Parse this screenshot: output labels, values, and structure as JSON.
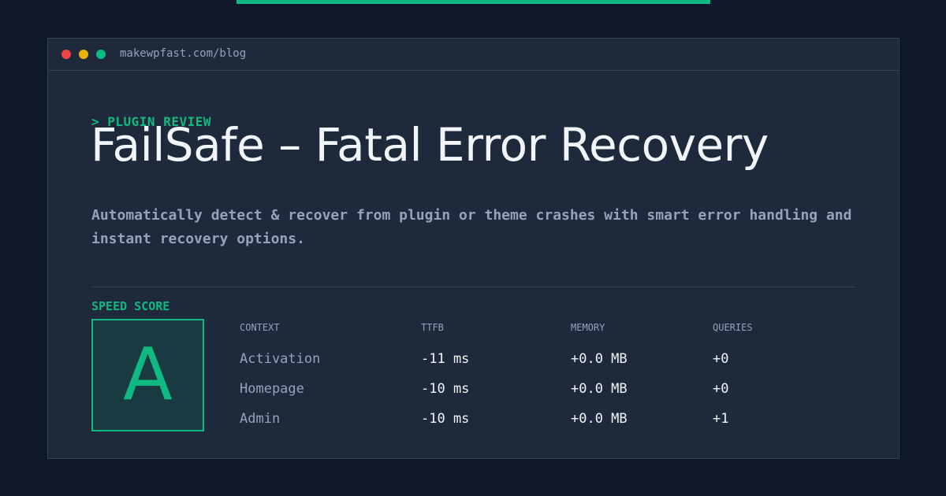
{
  "window": {
    "url": "makewpfast.com/blog"
  },
  "article": {
    "eyebrow": "> PLUGIN REVIEW",
    "title": "FailSafe – Fatal Error Recovery",
    "description": "Automatically detect & recover from plugin or theme crashes with smart error handling and instant recovery options."
  },
  "score": {
    "label": "SPEED SCORE",
    "grade": "A"
  },
  "table": {
    "headers": [
      "CONTEXT",
      "TTFB",
      "MEMORY",
      "QUERIES"
    ],
    "rows": [
      [
        "Activation",
        "-11 ms",
        "+0.0 MB",
        "+0"
      ],
      [
        "Homepage",
        "-10 ms",
        "+0.0 MB",
        "+0"
      ],
      [
        "Admin",
        "-10 ms",
        "+0.0 MB",
        "+1"
      ]
    ]
  },
  "colors": {
    "background": "#0f172a",
    "panel": "#1e293b",
    "accent": "#10b981",
    "text": "#f1f5f9",
    "muted": "#94a3b8"
  }
}
